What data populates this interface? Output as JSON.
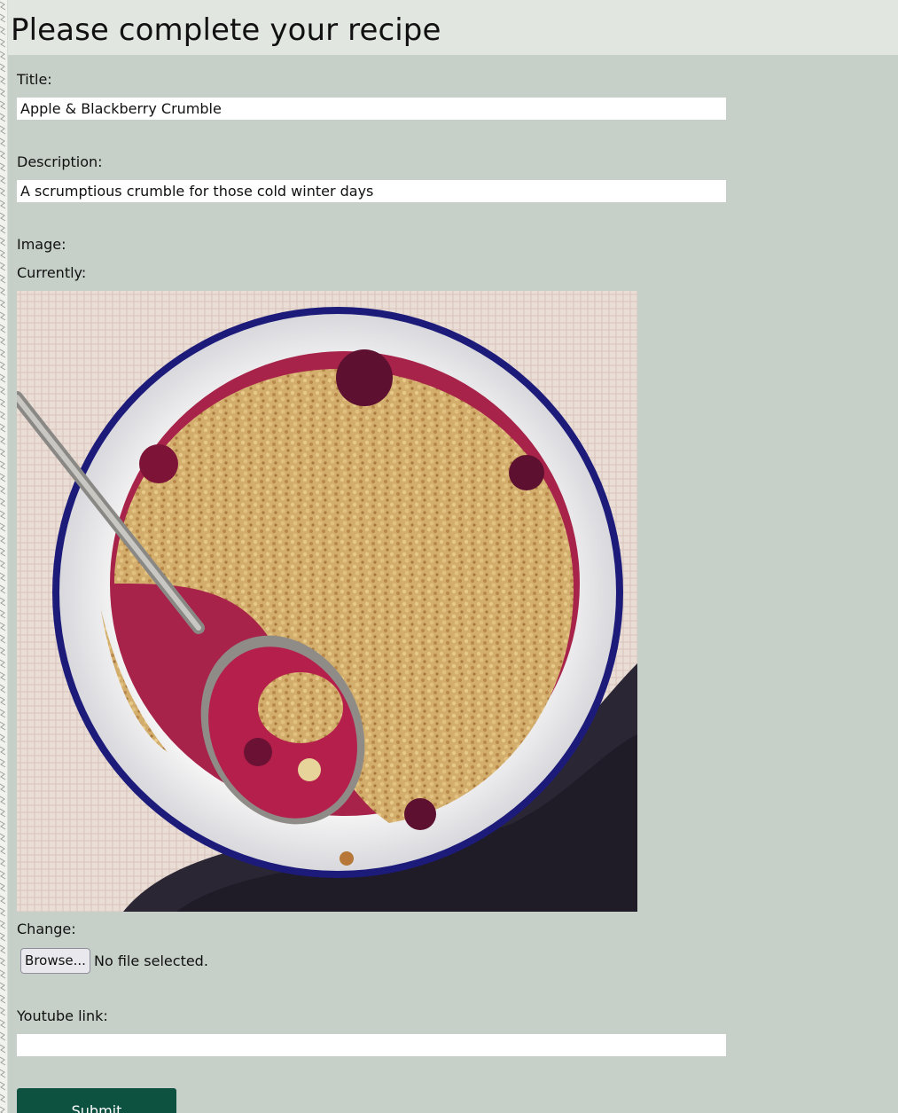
{
  "page": {
    "title": "Please complete your recipe"
  },
  "form": {
    "title_label": "Title:",
    "title_value": "Apple & Blackberry Crumble",
    "description_label": "Description:",
    "description_value": "A scrumptious crumble for those cold winter days",
    "image_label": "Image:",
    "currently_label": "Currently:",
    "image_alt": "Apple & Blackberry Crumble",
    "change_label": "Change:",
    "browse_label": "Browse...",
    "file_status": "No file selected.",
    "youtube_label": "Youtube link:",
    "youtube_value": "",
    "submit_label": "Submit"
  },
  "colors": {
    "background": "#c6d0c8",
    "header": "#e2e6e1",
    "submit": "#0d5140"
  }
}
